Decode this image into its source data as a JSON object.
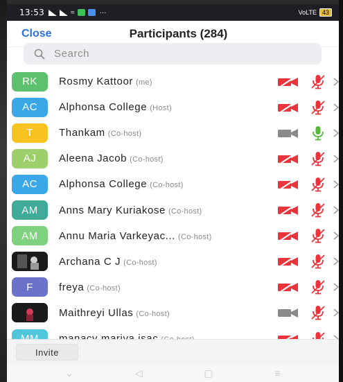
{
  "status_bar": {
    "time": "13:53",
    "dots": "···",
    "right_text": "VoLTE",
    "battery": "43"
  },
  "header": {
    "close_label": "Close",
    "title": "Participants (284)"
  },
  "search": {
    "placeholder": "Search",
    "value": ""
  },
  "participants": [
    {
      "initials": "RK",
      "name": "Rosmy Kattoor",
      "role": "(me)",
      "avatar_color": "#5dc06d",
      "cam": "off",
      "mic": "muted"
    },
    {
      "initials": "AC",
      "name": "Alphonsa College",
      "role": "(Host)",
      "avatar_color": "#3aa8e8",
      "cam": "off",
      "mic": "muted"
    },
    {
      "initials": "T",
      "name": "Thankam",
      "role": "(Co-host)",
      "avatar_color": "#f6c320",
      "cam": "on",
      "mic": "on"
    },
    {
      "initials": "AJ",
      "name": "Aleena Jacob",
      "role": "(Co-host)",
      "avatar_color": "#9dd06a",
      "cam": "off",
      "mic": "muted"
    },
    {
      "initials": "AC",
      "name": "Alphonsa College",
      "role": "(Co-host)",
      "avatar_color": "#3aa8e8",
      "cam": "off",
      "mic": "muted"
    },
    {
      "initials": "AM",
      "name": "Anns Mary Kuriakose",
      "role": "(Co-host)",
      "avatar_color": "#3fab98",
      "cam": "off",
      "mic": "muted"
    },
    {
      "initials": "AM",
      "name": "Annu Maria Varkeyac...",
      "role": "(Co-host)",
      "avatar_color": "#7ed17e",
      "cam": "off",
      "mic": "muted"
    },
    {
      "initials": "",
      "name": "Archana C J",
      "role": "(Co-host)",
      "avatar_color": "#1b1b1b",
      "photo": true,
      "cam": "off",
      "mic": "muted"
    },
    {
      "initials": "F",
      "name": "freya",
      "role": "(Co-host)",
      "avatar_color": "#6a72c9",
      "cam": "off",
      "mic": "muted"
    },
    {
      "initials": "",
      "name": "Maithreyi Ullas",
      "role": "(Co-host)",
      "avatar_color": "#1b1b1b",
      "photo": true,
      "cam": "on",
      "mic": "muted"
    },
    {
      "initials": "MM",
      "name": "manacy mariya isac",
      "role": "(Co-host)",
      "avatar_color": "#4fc6dc",
      "cam": "off",
      "mic": "muted"
    }
  ],
  "footer": {
    "invite_label": "Invite"
  },
  "colors": {
    "accent": "#2d6fdc",
    "muted_red": "#e8343a",
    "mic_green": "#55b83a",
    "cam_gray": "#8a8a8a"
  }
}
